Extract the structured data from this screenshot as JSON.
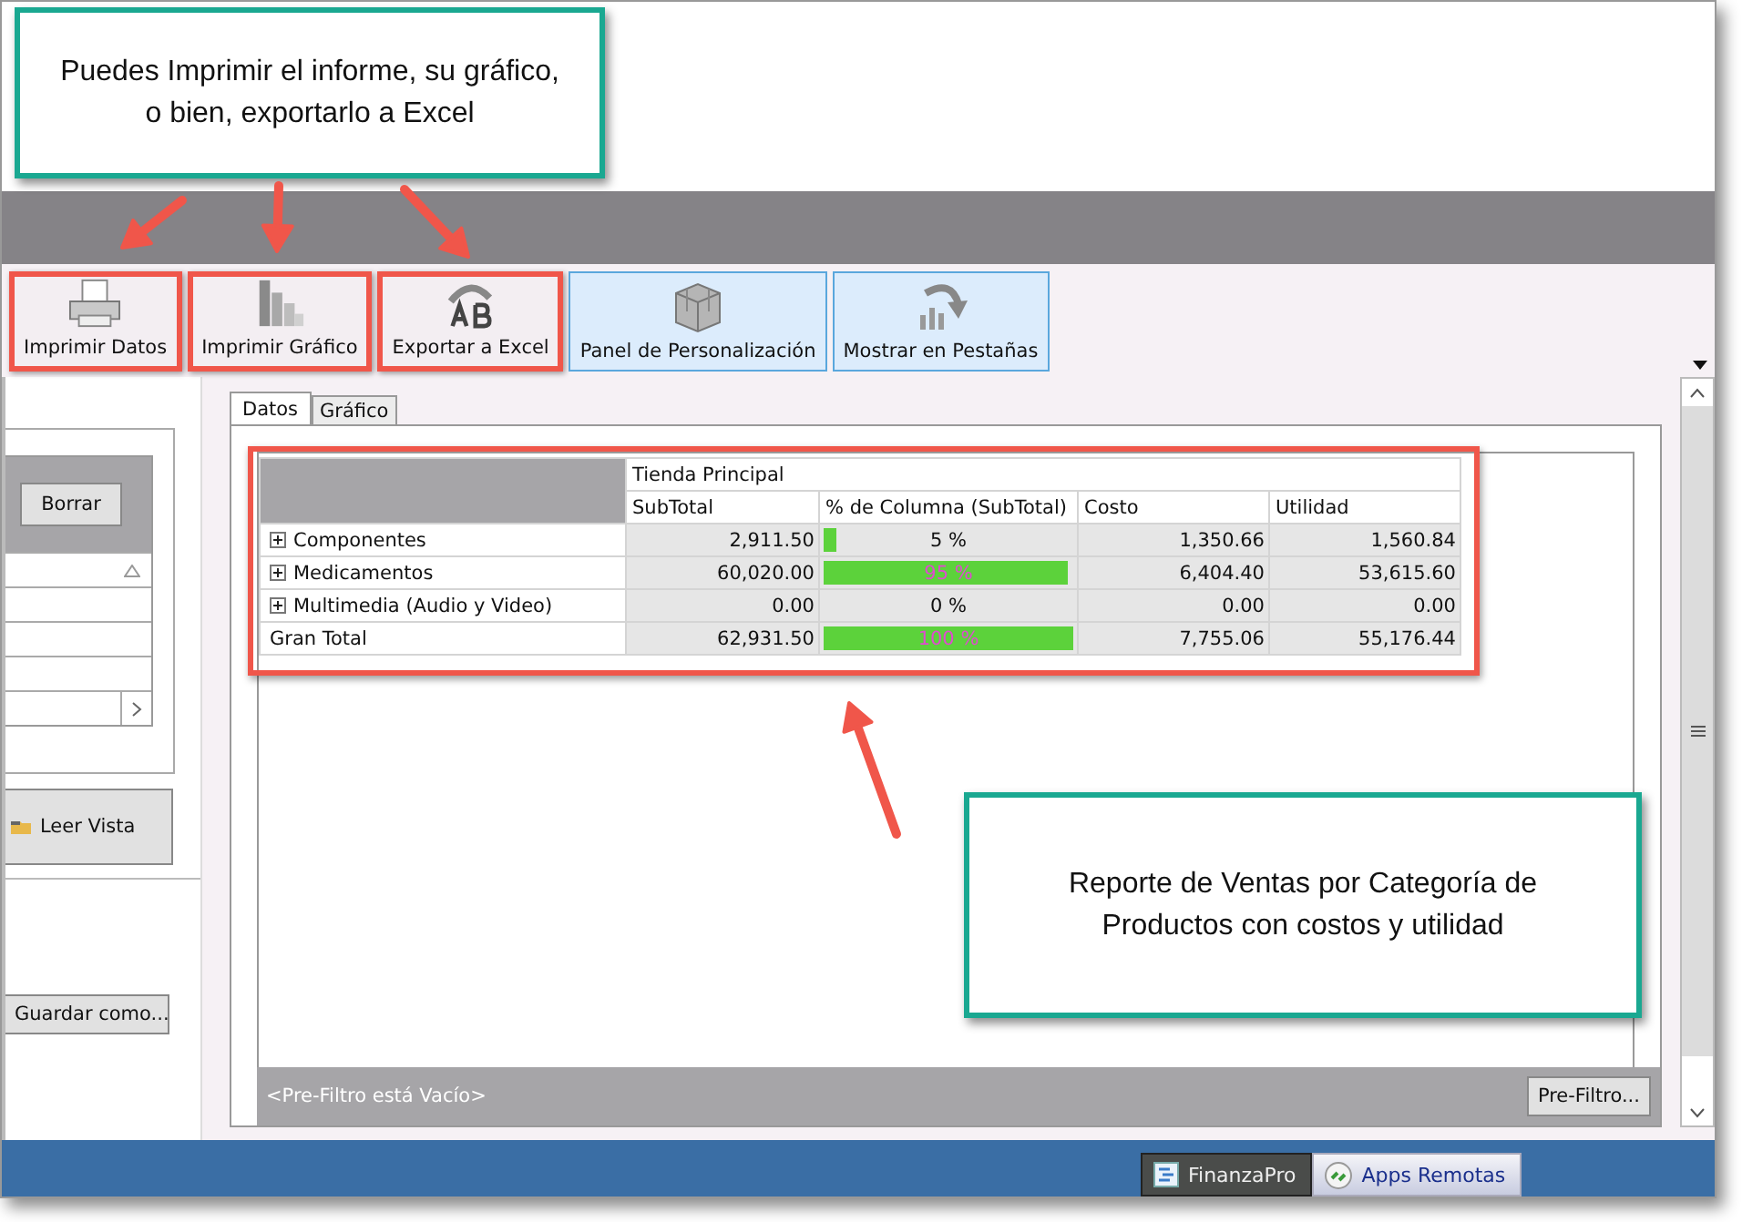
{
  "callouts": [
    {
      "text": "Puedes Imprimir el informe, su gráfico, o bien, exportarlo a Excel"
    },
    {
      "text": "Reporte de Ventas por Categoría de Productos con costos y utilidad"
    }
  ],
  "toolbar": [
    {
      "label": "Imprimir Datos",
      "highlighted": true,
      "checked": false
    },
    {
      "label": "Imprimir Gráfico",
      "highlighted": true,
      "checked": false
    },
    {
      "label": "Exportar a Excel",
      "highlighted": true,
      "checked": false
    },
    {
      "label": "Panel de Personalización",
      "highlighted": false,
      "checked": true
    },
    {
      "label": "Mostrar en Pestañas",
      "highlighted": false,
      "checked": true
    }
  ],
  "left_panel": {
    "clear_button": "Borrar",
    "load_button": "Leer Vista",
    "save_button": "Guardar como..."
  },
  "tabs": [
    {
      "label": "Datos",
      "selected": true
    },
    {
      "label": "Gráfico",
      "selected": false
    }
  ],
  "pivot": {
    "highlighted": true,
    "group_header": "Tienda Principal",
    "columns": [
      "SubTotal",
      "% de Columna (SubTotal)",
      "Costo",
      "Utilidad"
    ],
    "rows": [
      {
        "kind": "category",
        "label": "Componentes",
        "subtotal": "2,911.50",
        "percent": "5 %",
        "level": 0.05,
        "costo": "1,350.66",
        "utilidad": "1,560.84"
      },
      {
        "kind": "category",
        "label": "Medicamentos",
        "subtotal": "60,020.00",
        "percent": "95 %",
        "level": 0.95,
        "costo": "6,404.40",
        "utilidad": "53,615.60"
      },
      {
        "kind": "category",
        "label": "Multimedia (Audio y Video)",
        "subtotal": "0.00",
        "percent": "0 %",
        "costo": "0.00",
        "utilidad": "0.00"
      },
      {
        "kind": "total",
        "label": "Gran Total",
        "subtotal": "62,931.50",
        "percent": "100 %",
        "level": 1,
        "costo": "7,755.06",
        "utilidad": "55,176.44"
      }
    ]
  },
  "prefilter": {
    "status": "<Pre-Filtro está Vacío>",
    "button": "Pre-Filtro..."
  },
  "taskbar": [
    {
      "label": "FinanzaPro",
      "selected": false
    },
    {
      "label": "Apps Remotas",
      "selected": true
    }
  ]
}
